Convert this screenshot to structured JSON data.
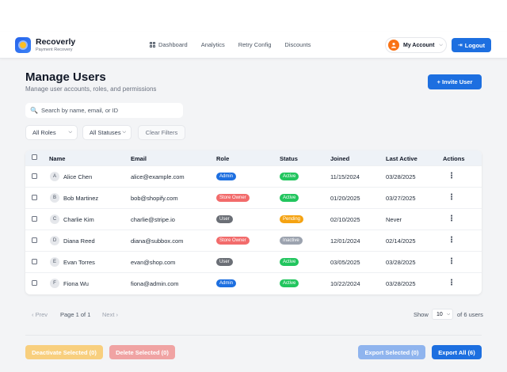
{
  "app": {
    "name": "Recoverly",
    "subtitle": "Payment Recovery"
  },
  "nav": {
    "links": [
      {
        "label": "Dashboard",
        "icon": "grid-icon"
      },
      {
        "label": "Analytics"
      },
      {
        "label": "Retry Config"
      },
      {
        "label": "Discounts"
      }
    ],
    "account_label": "My Account",
    "logout_label": "Logout"
  },
  "page": {
    "title": "Manage Users",
    "subtitle": "Manage user accounts, roles, and permissions",
    "invite_label": "+ Invite User"
  },
  "filters": {
    "search_placeholder": "Search by name, email, or ID",
    "roles_selected": "All Roles",
    "statuses_selected": "All Statuses",
    "clear_label": "Clear Filters"
  },
  "table": {
    "headers": [
      "Name",
      "Email",
      "Role",
      "Status",
      "Joined",
      "Last Active",
      "Actions"
    ],
    "rows": [
      {
        "initial": "A",
        "name": "Alice Chen",
        "email": "alice@example.com",
        "role": "Admin",
        "status": "Active",
        "joined": "11/15/2024",
        "last_active": "03/28/2025"
      },
      {
        "initial": "B",
        "name": "Bob Martinez",
        "email": "bob@shopify.com",
        "role": "Store Owner",
        "status": "Active",
        "joined": "01/20/2025",
        "last_active": "03/27/2025"
      },
      {
        "initial": "C",
        "name": "Charlie Kim",
        "email": "charlie@stripe.io",
        "role": "User",
        "status": "Pending",
        "joined": "02/10/2025",
        "last_active": "Never"
      },
      {
        "initial": "D",
        "name": "Diana Reed",
        "email": "diana@subbox.com",
        "role": "Store Owner",
        "status": "Inactive",
        "joined": "12/01/2024",
        "last_active": "02/14/2025"
      },
      {
        "initial": "E",
        "name": "Evan Torres",
        "email": "evan@shop.com",
        "role": "User",
        "status": "Active",
        "joined": "03/05/2025",
        "last_active": "03/28/2025"
      },
      {
        "initial": "F",
        "name": "Fiona Wu",
        "email": "fiona@admin.com",
        "role": "Admin",
        "status": "Active",
        "joined": "10/22/2024",
        "last_active": "03/28/2025"
      }
    ]
  },
  "pagination": {
    "prev_label": "‹ Prev",
    "page_info": "Page 1 of 1",
    "next_label": "Next ›",
    "show_label": "Show",
    "per_page": "10",
    "total_label": "of 6 users"
  },
  "bulk": {
    "deactivate_label": "Deactivate Selected (0)",
    "delete_label": "Delete Selected (0)",
    "export_selected_label": "Export Selected (0)",
    "export_all_label": "Export All (6)"
  },
  "colors": {
    "primary": "#1d6fe0",
    "role_admin": "#1d6fe0",
    "role_store_owner": "#f26b6b",
    "role_user": "#6b6f76",
    "status_active": "#22c55e",
    "status_pending": "#f5a312",
    "status_inactive": "#9ca3af"
  }
}
